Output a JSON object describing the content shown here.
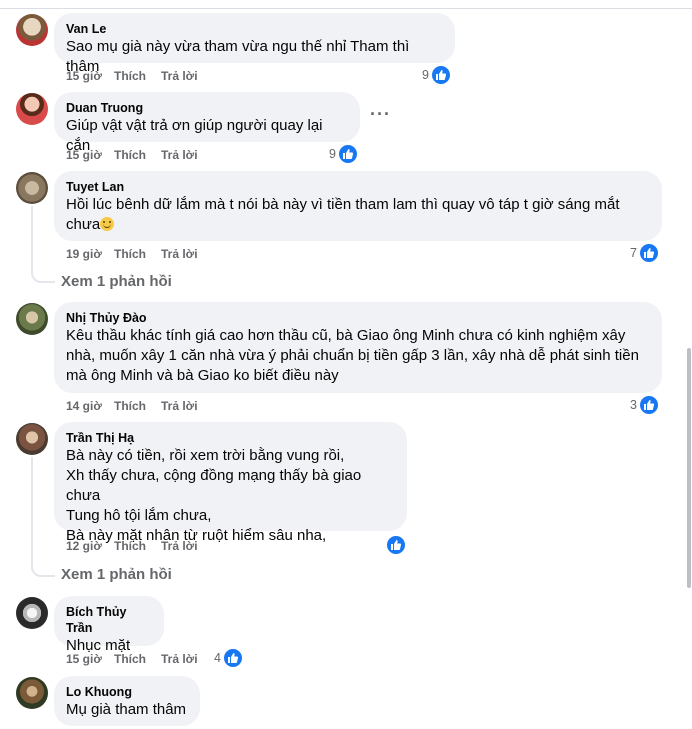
{
  "colors": {
    "like_blue": "#1877f2",
    "bubble": "#f0f2f5",
    "meta_gray": "#65676b"
  },
  "comments": [
    {
      "author": "Van Le",
      "lines": [
        "Sao mụ già này vừa tham vừa ngu thế nhỉ Tham thì thâm"
      ],
      "time": "15 giờ",
      "like": "Thích",
      "reply": "Trả lời",
      "likes": "9"
    },
    {
      "author": "Duan Truong",
      "lines": [
        "Giúp vật vật trả ơn giúp người quay lại cắn"
      ],
      "time": "15 giờ",
      "like": "Thích",
      "reply": "Trả lời",
      "likes": "9",
      "more": "···"
    },
    {
      "author": "Tuyet Lan",
      "lines": [
        "Hồi lúc bênh dữ lắm mà t nói bà này vì tiền tham lam thì quay vô táp t giờ sáng mắt",
        "chưa"
      ],
      "time": "19 giờ",
      "like": "Thích",
      "reply": "Trả lời",
      "likes": "7",
      "view_replies": "Xem 1 phản hồi"
    },
    {
      "author": "Nhị Thủy Đào",
      "lines": [
        "Kêu thầu khác tính giá cao hơn thầu cũ, bà Giao ông Minh chưa có kinh nghiệm xây",
        "nhà, muốn xây 1 căn nhà vừa ý phải chuẩn bị tiền gấp 3 lần, xây nhà dễ phát sinh tiền",
        "mà ông Minh và bà Giao ko biết điều này"
      ],
      "time": "14 giờ",
      "like": "Thích",
      "reply": "Trả lời",
      "likes": "3"
    },
    {
      "author": "Trần Thị Hạ",
      "lines": [
        "Bà này có tiền, rồi xem trời bằng vung rồi,",
        "Xh thấy chưa, cộng đồng mạng thấy bà giao chưa",
        "Tung hô tội lắm chưa,",
        "Bà này mặt nhân từ ruột hiểm sâu nha,"
      ],
      "time": "12 giờ",
      "like": "Thích",
      "reply": "Trả lời",
      "likes": "",
      "view_replies": "Xem 1 phản hồi"
    },
    {
      "author": "Bích Thủy Trần",
      "lines": [
        "Nhục mặt"
      ],
      "time": "15 giờ",
      "like": "Thích",
      "reply": "Trả lời",
      "likes": "4"
    },
    {
      "author": "Lo Khuong",
      "lines": [
        "Mụ già tham thâm"
      ]
    }
  ]
}
